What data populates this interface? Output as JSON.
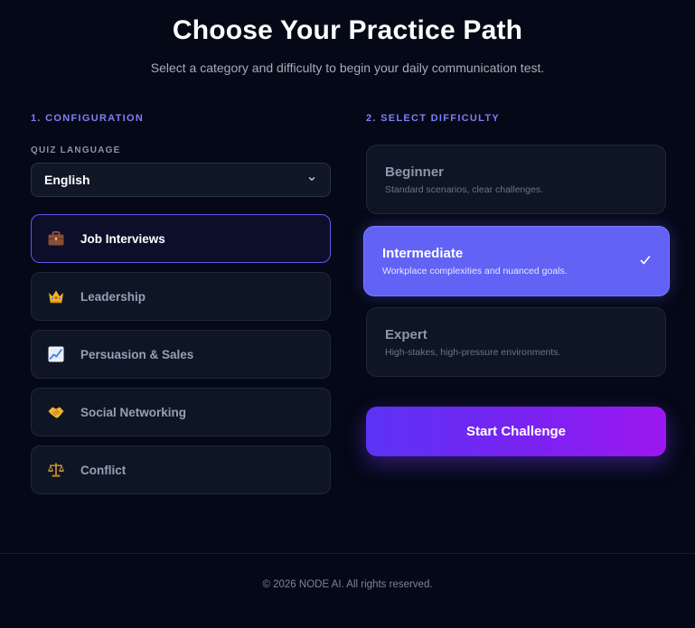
{
  "header": {
    "title": "Choose Your Practice Path",
    "subtitle": "Select a category and difficulty to begin your daily communication test."
  },
  "configuration": {
    "section_label": "1. CONFIGURATION",
    "language_label": "QUIZ LANGUAGE",
    "language_value": "English",
    "categories": [
      {
        "label": "Job Interviews",
        "icon": "briefcase-icon",
        "active": true
      },
      {
        "label": "Leadership",
        "icon": "crown-icon",
        "active": false
      },
      {
        "label": "Persuasion & Sales",
        "icon": "chart-increasing-icon",
        "active": false
      },
      {
        "label": "Social Networking",
        "icon": "handshake-icon",
        "active": false
      },
      {
        "label": "Conflict",
        "icon": "balance-scale-icon",
        "active": false
      }
    ]
  },
  "difficulty": {
    "section_label": "2. SELECT DIFFICULTY",
    "options": [
      {
        "title": "Beginner",
        "desc": "Standard scenarios, clear challenges.",
        "selected": false
      },
      {
        "title": "Intermediate",
        "desc": "Workplace complexities and nuanced goals.",
        "selected": true
      },
      {
        "title": "Expert",
        "desc": "High-stakes, high-pressure environments.",
        "selected": false
      }
    ],
    "start_button": "Start Challenge"
  },
  "footer": {
    "text": "© 2026 NODE AI. All rights reserved."
  },
  "colors": {
    "background": "#050816",
    "accent": "#6262f5",
    "section_label": "#7c7ff8",
    "button_gradient_start": "#5b33f5",
    "button_gradient_end": "#9d17f0"
  }
}
